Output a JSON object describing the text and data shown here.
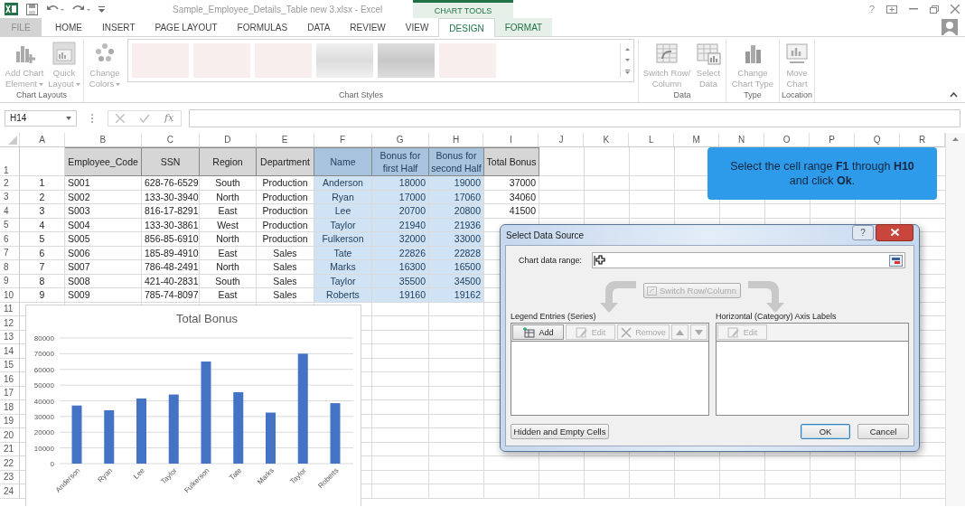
{
  "title_bar": {
    "title": "Sample_Employee_Details_Table new 3.xlsx - Excel",
    "context_label": "CHART TOOLS",
    "help": "?"
  },
  "tabs": [
    {
      "label": "FILE",
      "kind": "file",
      "selected": false
    },
    {
      "label": "HOME",
      "kind": "normal",
      "selected": false
    },
    {
      "label": "INSERT",
      "kind": "normal",
      "selected": false
    },
    {
      "label": "PAGE LAYOUT",
      "kind": "normal",
      "selected": false
    },
    {
      "label": "FORMULAS",
      "kind": "normal",
      "selected": false
    },
    {
      "label": "DATA",
      "kind": "normal",
      "selected": false
    },
    {
      "label": "REVIEW",
      "kind": "normal",
      "selected": false
    },
    {
      "label": "VIEW",
      "kind": "normal",
      "selected": false
    },
    {
      "label": "DESIGN",
      "kind": "context",
      "selected": true
    },
    {
      "label": "FORMAT",
      "kind": "context",
      "selected": false
    }
  ],
  "ribbon": {
    "groups": [
      {
        "label": "Chart Layouts",
        "buttons": [
          {
            "kind": "add-element",
            "lines": [
              "Add Chart",
              "Element"
            ],
            "dropdown": true
          },
          {
            "kind": "quick-layout",
            "lines": [
              "Quick",
              "Layout"
            ],
            "dropdown": true
          }
        ]
      },
      {
        "label": "Chart Styles",
        "gallery": true,
        "buttons": [
          {
            "kind": "colors",
            "lines": [
              "Change",
              "Colors"
            ],
            "dropdown": true
          }
        ]
      },
      {
        "label": "Data",
        "buttons": [
          {
            "kind": "switch",
            "lines": [
              "Switch Row/",
              "Column"
            ]
          },
          {
            "kind": "select-data",
            "lines": [
              "Select",
              "Data"
            ]
          }
        ]
      },
      {
        "label": "Type",
        "buttons": [
          {
            "kind": "chart-type",
            "lines": [
              "Change",
              "Chart Type"
            ]
          }
        ]
      },
      {
        "label": "Location",
        "buttons": [
          {
            "kind": "move-chart",
            "lines": [
              "Move",
              "Chart"
            ]
          }
        ]
      }
    ]
  },
  "formula_bar": {
    "name_box": "H14",
    "fx": "fx"
  },
  "sheet": {
    "column_letters": [
      "A",
      "B",
      "C",
      "D",
      "E",
      "F",
      "G",
      "H",
      "I",
      "J",
      "K",
      "L",
      "M",
      "N",
      "O",
      "P",
      "Q",
      "R"
    ],
    "row_numbers": [
      "1",
      "2",
      "3",
      "4",
      "5",
      "6",
      "7",
      "8",
      "9",
      "10",
      "11",
      "12",
      "13",
      "14",
      "15",
      "16",
      "17",
      "18",
      "19",
      "20",
      "21",
      "22",
      "23",
      "24"
    ],
    "headers": [
      {
        "text": "Employee_Code",
        "selected": false
      },
      {
        "text": "SSN",
        "selected": false
      },
      {
        "text": "Region",
        "selected": false
      },
      {
        "text": "Department",
        "selected": false
      },
      {
        "text": "Name",
        "selected": true
      },
      {
        "text": "Bonus for first Half",
        "selected": true
      },
      {
        "text": "Bonus for second Half",
        "selected": true
      },
      {
        "text": "Total Bonus",
        "selected": false
      }
    ],
    "rows": [
      [
        "1",
        "S001",
        "628-76-6529",
        "South",
        "Production",
        "Anderson",
        "18000",
        "19000",
        "37000"
      ],
      [
        "2",
        "S002",
        "133-30-3940",
        "North",
        "Production",
        "Ryan",
        "17000",
        "17060",
        "34060"
      ],
      [
        "3",
        "S003",
        "816-17-8291",
        "East",
        "Production",
        "Lee",
        "20700",
        "20800",
        "41500"
      ],
      [
        "4",
        "S004",
        "133-30-3861",
        "West",
        "Production",
        "Taylor",
        "21940",
        "21936"
      ],
      [
        "5",
        "S005",
        "856-85-6910",
        "North",
        "Production",
        "Fulkerson",
        "32000",
        "33000"
      ],
      [
        "6",
        "S006",
        "185-89-4910",
        "East",
        "Sales",
        "Tate",
        "22826",
        "22828"
      ],
      [
        "7",
        "S007",
        "786-48-2491",
        "North",
        "Sales",
        "Marks",
        "16300",
        "16500"
      ],
      [
        "8",
        "S008",
        "421-40-2831",
        "South",
        "Sales",
        "Taylor",
        "35500",
        "34500"
      ],
      [
        "9",
        "S009",
        "785-74-8097",
        "East",
        "Sales",
        "Roberts",
        "19160",
        "19162"
      ]
    ]
  },
  "chart": {
    "chart_data": {
      "type": "bar",
      "title": "Total Bonus",
      "categories": [
        "Anderson",
        "Ryan",
        "Lee",
        "Taylor",
        "Fulkerson",
        "Tate",
        "Marks",
        "Taylor",
        "Roberts"
      ],
      "values": [
        37000,
        34000,
        41500,
        44000,
        65000,
        45500,
        32500,
        70000,
        38500
      ],
      "ylim": [
        0,
        80000
      ],
      "grid": true,
      "yticks": [
        0,
        10000,
        20000,
        30000,
        40000,
        50000,
        60000,
        70000,
        80000
      ]
    }
  },
  "callout": {
    "text": "Select the cell range **F1** through **H10** and click **Ok**."
  },
  "dialog": {
    "title": "Select Data Source",
    "help": "?",
    "range_label": "Chart data range:",
    "switch_button": {
      "label": "Switch Row/Column",
      "disabled": true
    },
    "legend": {
      "label": "Legend Entries (Series)",
      "buttons": [
        {
          "kind": "add",
          "label": "Add",
          "disabled": false
        },
        {
          "kind": "edit",
          "label": "Edit",
          "disabled": true
        },
        {
          "kind": "remove",
          "label": "Remove",
          "disabled": true
        },
        {
          "kind": "up",
          "disabled": true
        },
        {
          "kind": "down",
          "disabled": true
        }
      ]
    },
    "axis": {
      "label": "Horizontal (Category) Axis Labels",
      "buttons": [
        {
          "kind": "edit",
          "label": "Edit",
          "disabled": true
        }
      ]
    },
    "hidden_button": "Hidden and Empty Cells",
    "ok": {
      "label": "OK",
      "default": true
    },
    "cancel": "Cancel"
  }
}
